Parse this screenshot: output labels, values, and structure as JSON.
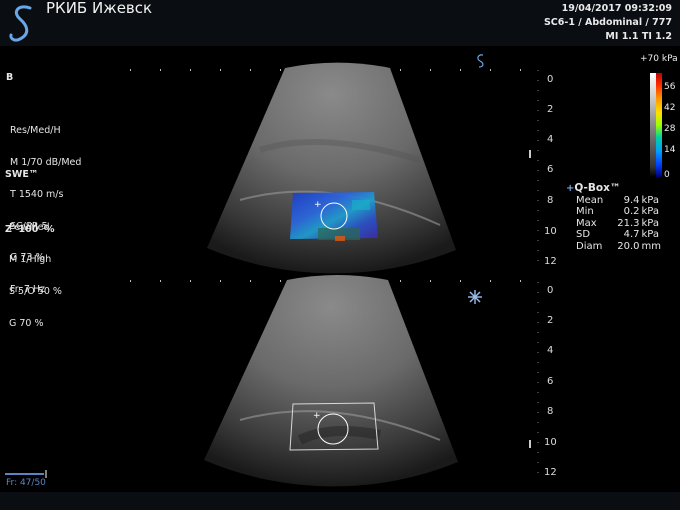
{
  "header": {
    "site": "РКИБ Ижевск",
    "datetime": "19/04/2017 09:32:09",
    "probe_preset": "SC6-1 / Abdominal / 777",
    "indices": "MI 1.1  TI 1.2"
  },
  "params_b": {
    "title": "B",
    "lines": [
      "Res/Med/H",
      "M 1/70 dB/Med",
      "T 1540 m/s",
      "SC/SR 5",
      "G 73 %",
      "Fr. 7 Hz"
    ]
  },
  "params_swe": {
    "title": "SWE™",
    "lines": [
      "Pen/Med",
      "M 1/High",
      "S 5/O 50 %",
      "G 70 %"
    ]
  },
  "zoom": "Z  100  %",
  "depth_ticks_top": [
    "0",
    "2",
    "4",
    "6",
    "8",
    "10",
    "12"
  ],
  "depth_ticks_bottom": [
    "0",
    "2",
    "4",
    "6",
    "8",
    "10",
    "12"
  ],
  "colorbar": {
    "max_label": "+70 kPa",
    "labels": [
      "56",
      "42",
      "28",
      "14",
      "0"
    ]
  },
  "qbox": {
    "title": "Q-Box™",
    "rows": [
      {
        "label": "Mean",
        "value": "9.4",
        "unit": "kPa"
      },
      {
        "label": "Min",
        "value": "0.2",
        "unit": "kPa"
      },
      {
        "label": "Max",
        "value": "21.3",
        "unit": "kPa"
      },
      {
        "label": "SD",
        "value": "4.7",
        "unit": "kPa"
      },
      {
        "label": "Diam",
        "value": "20.0",
        "unit": "mm"
      }
    ]
  },
  "frame": "Fr: 47/50",
  "icons": [
    "logo-icon",
    "freeze-snowflake-icon",
    "probe-orientation-icon",
    "cursor-plus-icon"
  ],
  "colors": {
    "accent": "#5a85c2",
    "background": "#000000"
  }
}
